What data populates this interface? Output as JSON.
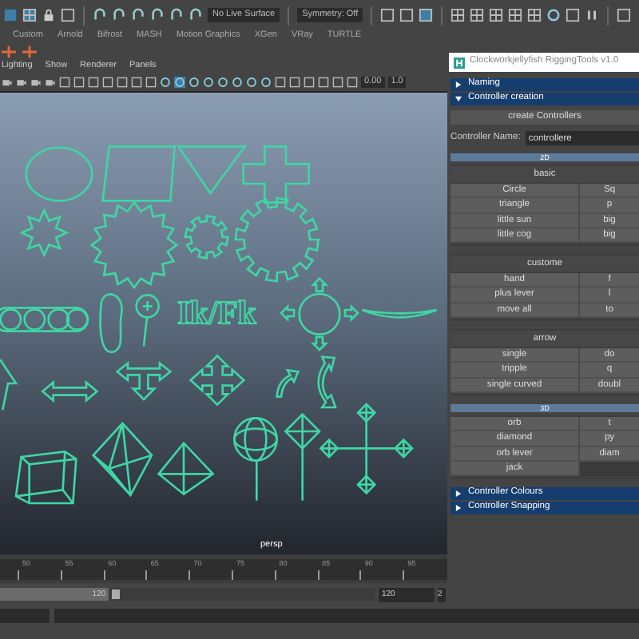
{
  "status_line": {
    "live_surface": "No Live Surface",
    "symmetry": "Symmetry: Off"
  },
  "shelf_tabs": [
    "Custom",
    "Arnold",
    "Bifrost",
    "MASH",
    "Motion Graphics",
    "XGen",
    "VRay",
    "TURTLE"
  ],
  "viewport": {
    "menu": [
      "Lighting",
      "Show",
      "Renderer",
      "Panels"
    ],
    "fields": [
      "0.00",
      "1.0"
    ],
    "label": "Ik/Fk",
    "camera": "persp"
  },
  "timeline": {
    "ticks": [
      "50",
      "55",
      "60",
      "65",
      "70",
      "75",
      "80",
      "85",
      "90",
      "95"
    ],
    "range_slider": {
      "label": "120",
      "level": 0.29
    },
    "end_field": "120",
    "next_field": "2"
  },
  "tool_window": {
    "title": "Clockworkjellyfish RiggingTools v1.0",
    "sections": [
      {
        "label": "Naming",
        "expanded": false
      },
      {
        "label": "Controller creation",
        "expanded": true,
        "content": {
          "create_button": "create Controllers",
          "name_label": "Controller Name:",
          "name_value": "controllere",
          "groups": [
            {
              "title": "2D",
              "subgroups": [
                {
                  "title": "basic",
                  "buttons": [
                    [
                      "Circle",
                      "Sq"
                    ],
                    [
                      "triangle",
                      "p"
                    ],
                    [
                      "little sun",
                      "big"
                    ],
                    [
                      "little cog",
                      "big"
                    ]
                  ]
                },
                {
                  "title": "custome",
                  "buttons": [
                    [
                      "hand",
                      "f"
                    ],
                    [
                      "plus lever",
                      "l"
                    ],
                    [
                      "move all",
                      "to"
                    ]
                  ]
                },
                {
                  "title": "arrow",
                  "buttons": [
                    [
                      "single",
                      "do"
                    ],
                    [
                      "tripple",
                      "q"
                    ],
                    [
                      "single curved",
                      "doubl"
                    ]
                  ]
                }
              ]
            },
            {
              "title": "3D",
              "subgroups": [
                {
                  "buttons": [
                    [
                      "orb",
                      "t"
                    ],
                    [
                      "diamond",
                      "py"
                    ],
                    [
                      "orb lever",
                      "diam"
                    ],
                    [
                      "jack"
                    ]
                  ]
                }
              ]
            }
          ]
        }
      },
      {
        "label": "Controller Colours",
        "expanded": false
      },
      {
        "label": "Controller Snapping",
        "expanded": false
      }
    ]
  }
}
